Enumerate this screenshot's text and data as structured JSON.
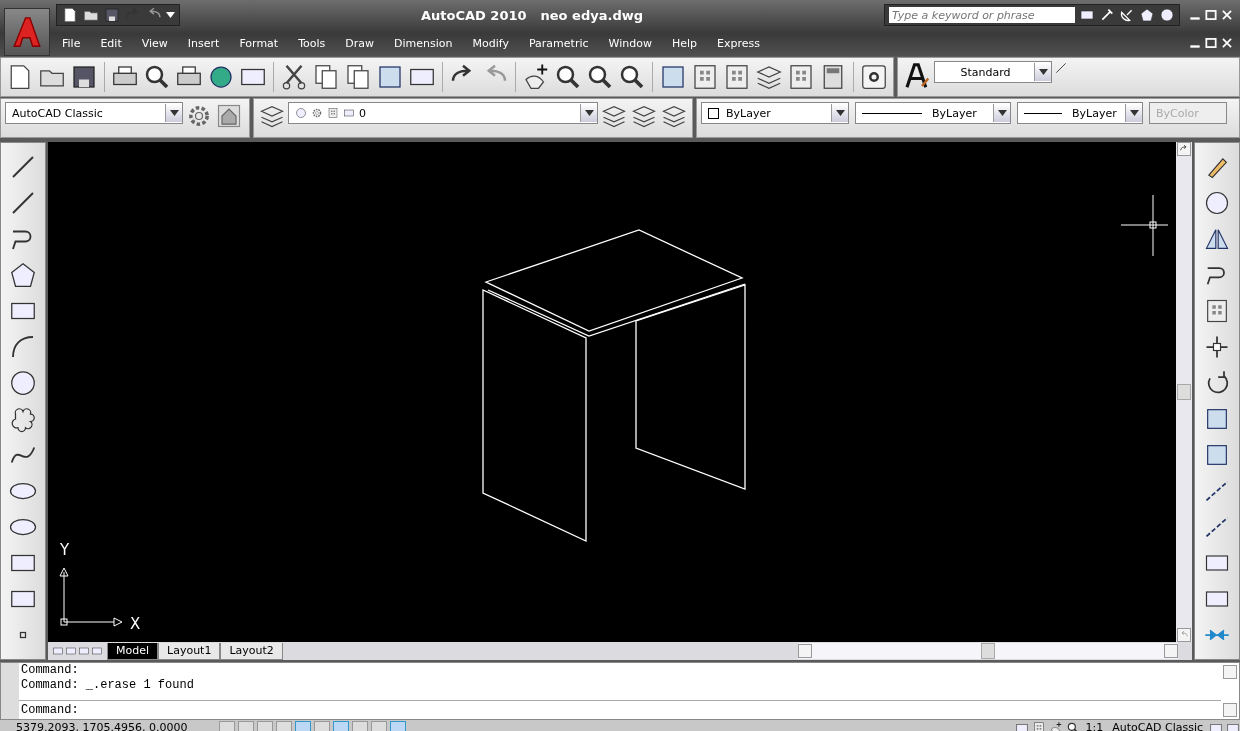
{
  "window": {
    "title": "AutoCAD 2010",
    "filename": "neo edya.dwg"
  },
  "search": {
    "placeholder": "Type a keyword or phrase"
  },
  "menu": [
    "File",
    "Edit",
    "View",
    "Insert",
    "Format",
    "Tools",
    "Draw",
    "Dimension",
    "Modify",
    "Parametric",
    "Window",
    "Help",
    "Express"
  ],
  "text_style": {
    "value": "Standard"
  },
  "workspace": {
    "value": "AutoCAD Classic"
  },
  "layer": {
    "value": "0"
  },
  "properties": {
    "color_setting": "ByLayer",
    "linetype": "ByLayer",
    "lineweight": "ByLayer",
    "plot_style": "ByColor",
    "plot_style_disabled": true
  },
  "axes": {
    "x": "X",
    "y": "Y"
  },
  "layout_tabs": [
    {
      "label": "Model",
      "selected": true
    },
    {
      "label": "Layout1",
      "selected": false
    },
    {
      "label": "Layout2",
      "selected": false
    }
  ],
  "command_history": [
    "Command:",
    "Command: _.erase 1 found"
  ],
  "command_prompt": "Command:",
  "status_toggles": [
    {
      "on": false
    },
    {
      "on": false
    },
    {
      "on": false
    },
    {
      "on": false
    },
    {
      "on": true
    },
    {
      "on": false
    },
    {
      "on": true
    },
    {
      "on": false
    },
    {
      "on": false
    },
    {
      "on": true
    }
  ],
  "status": {
    "coordinates": "5379.2093, 1705.4956, 0.0000",
    "annotation_scale": "1:1",
    "workspace": "AutoCAD Classic"
  }
}
